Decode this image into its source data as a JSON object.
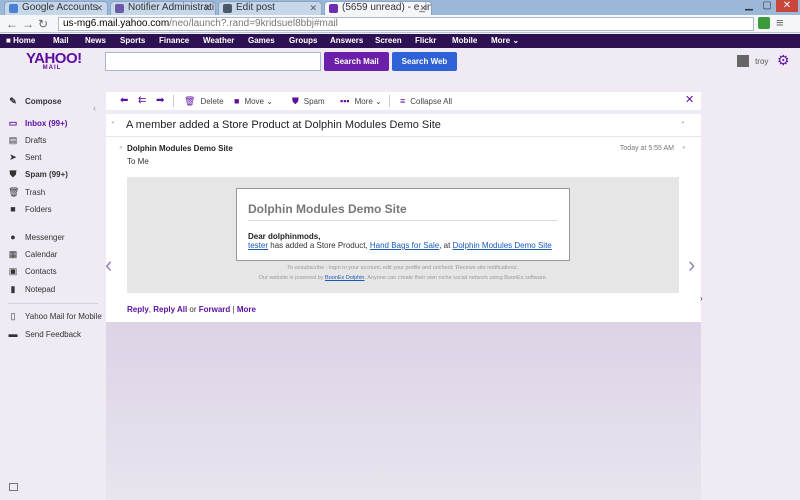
{
  "browser": {
    "tabs": [
      {
        "label": "Google Accounts",
        "active": false,
        "color": "#4a7fd4"
      },
      {
        "label": "Notifier Administrati",
        "active": false,
        "color": "#6a5aa8"
      },
      {
        "label": "Edit post",
        "active": false,
        "color": "#4a5a6a"
      },
      {
        "label": "(5659 unread) - e_ins",
        "active": true,
        "color": "#6d2fb0"
      }
    ],
    "url_host": "us-mg6.mail.yahoo.com",
    "url_path": "/neo/launch?.rand=9kridsuel8bbj#mail"
  },
  "ynav": {
    "items": [
      "Home",
      "Mail",
      "News",
      "Sports",
      "Finance",
      "Weather",
      "Games",
      "Groups",
      "Answers",
      "Screen",
      "Flickr",
      "Mobile",
      "More"
    ]
  },
  "header": {
    "logo_main": "YAHOO!",
    "logo_sub": "MAIL",
    "search_mail_label": "Search Mail",
    "search_web_label": "Search Web",
    "search_placeholder": "",
    "username": "troy"
  },
  "sidebar": {
    "items": [
      {
        "label": "Compose",
        "icon": "compose-icon"
      },
      {
        "label": "Inbox (99+)",
        "icon": "inbox-icon"
      },
      {
        "label": "Drafts",
        "icon": "drafts-icon"
      },
      {
        "label": "Sent",
        "icon": "sent-icon"
      },
      {
        "label": "Spam (99+)",
        "icon": "spam-icon"
      },
      {
        "label": "Trash",
        "icon": "trash-icon"
      },
      {
        "label": "Folders",
        "icon": "folder-icon"
      },
      {
        "label": "Messenger",
        "icon": "messenger-icon"
      },
      {
        "label": "Calendar",
        "icon": "calendar-icon"
      },
      {
        "label": "Contacts",
        "icon": "contacts-icon"
      },
      {
        "label": "Notepad",
        "icon": "notepad-icon"
      },
      {
        "label": "Yahoo Mail for Mobile",
        "icon": "mobile-icon"
      },
      {
        "label": "Send Feedback",
        "icon": "feedback-icon"
      }
    ]
  },
  "toolbar": {
    "delete": "Delete",
    "move": "Move",
    "spam": "Spam",
    "more": "More",
    "collapse_all": "Collapse All"
  },
  "message": {
    "subject": "A member added a Store Product at Dolphin Modules Demo Site",
    "from": "Dolphin Modules Demo Site",
    "to": "To  Me",
    "date": "Today at 5:55 AM",
    "card_title": "Dolphin Modules Demo Site",
    "greeting": "Dear dolphinmods,",
    "body_user": "tester",
    "body_text1": " has added a Store Product, ",
    "body_product": "Hand Bags for Sale",
    "body_text2": ", at ",
    "body_site": "Dolphin Modules Demo Site",
    "footer1": "To unsubscribe - login to your account, edit your profile and uncheck 'Receive site notifications'.",
    "footer2_a": "Our website is powered by ",
    "footer2_link": "BoonEx Dolphin",
    "footer2_b": ". Anyone can create their own niche social network using BoonEx software."
  },
  "reply": {
    "reply": "Reply",
    "reply_all": "Reply All",
    "or": " or ",
    "forward": "Forward",
    "sep": " | ",
    "more": "More"
  },
  "colors": {
    "accent": "#5c0fa0",
    "nav_bg": "#2d1152",
    "search_mail": "#6c1fa8",
    "search_web": "#2f62d6"
  }
}
